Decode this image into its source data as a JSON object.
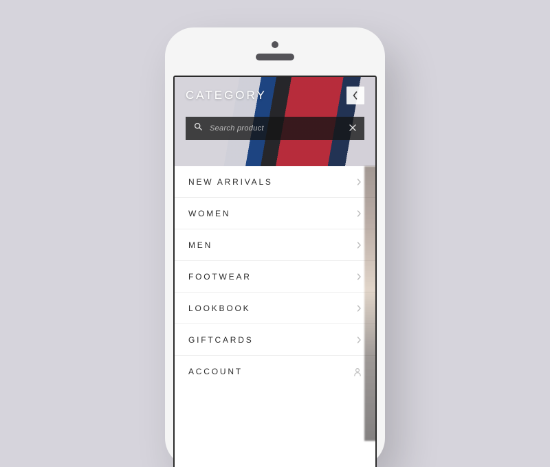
{
  "header": {
    "title": "CATEGORY"
  },
  "search": {
    "placeholder": "Search product"
  },
  "menu": {
    "items": [
      {
        "label": "NEW ARRIVALS",
        "icon": "chevron"
      },
      {
        "label": "WOMEN",
        "icon": "chevron"
      },
      {
        "label": "MEN",
        "icon": "chevron"
      },
      {
        "label": "FOOTWEAR",
        "icon": "chevron"
      },
      {
        "label": "LOOKBOOK",
        "icon": "chevron"
      },
      {
        "label": "GIFTCARDS",
        "icon": "chevron"
      },
      {
        "label": "ACCOUNT",
        "icon": "user"
      }
    ]
  },
  "colors": {
    "page_bg": "#d6d4dc",
    "text": "#2b2b2b",
    "divider": "#eeeeee",
    "search_bg": "rgba(20,20,20,0.78)"
  }
}
